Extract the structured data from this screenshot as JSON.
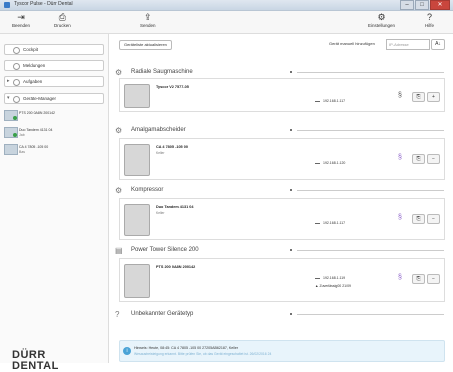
{
  "window": {
    "title": "Tyscor Pulse - Dürr Dental",
    "close": "✕",
    "min": "–",
    "max": "□"
  },
  "toolbar": {
    "beenden": {
      "label": "Beenden",
      "icon": "exit-icon"
    },
    "drucken": {
      "label": "Drucken",
      "icon": "printer-icon"
    },
    "senden": {
      "label": "Senden",
      "icon": "send-icon"
    },
    "einstellungen": {
      "label": "Einstellungen",
      "icon": "settings-icon"
    },
    "hilfe": {
      "label": "Hilfe",
      "icon": "help-icon"
    }
  },
  "sidebar": {
    "nav": [
      {
        "label": "Cockpit",
        "icon": "cockpit-icon"
      },
      {
        "label": "Meldungen",
        "icon": "messages-icon"
      },
      {
        "label": "Aufgaben",
        "icon": "tasks-icon"
      },
      {
        "label": "Geräte-Manager",
        "icon": "device-manager-icon"
      }
    ],
    "devices": [
      {
        "name": "PTS 200 0A8N 200142",
        "sub": ""
      },
      {
        "name": "Duo Tandem 4131 04",
        "sub": "Jab"
      },
      {
        "name": "CA 4 7805 -105 00",
        "sub": "Bas"
      }
    ],
    "logo": {
      "line1": "DÜRR",
      "line2": "DENTAL"
    }
  },
  "main": {
    "refresh_button": "Geräteliste aktualisieren",
    "manual_add": "Gerät manuell hinzufügen",
    "search_placeholder": "IP-Adresse",
    "sort_label": "A↓"
  },
  "sections": [
    {
      "title": "Radiale Saugmaschine",
      "icon": "suction-icon",
      "devices": [
        {
          "name": "Tyscor V2 7577-05",
          "status": "",
          "ip": "192.168.1.117",
          "extra": ""
        }
      ]
    },
    {
      "title": "Amalgamabscheider",
      "icon": "separator-icon",
      "devices": [
        {
          "name": "CA 4 7805 -105 00",
          "status": "Keller",
          "ip": "192.168.1.120",
          "extra": ""
        }
      ]
    },
    {
      "title": "Kompressor",
      "icon": "compressor-icon",
      "devices": [
        {
          "name": "Duo Tandem 4131 04",
          "status": "Keller",
          "ip": "192.168.1.117",
          "extra": ""
        }
      ]
    },
    {
      "title": "Power Tower Silence 200",
      "icon": "tower-icon",
      "devices": [
        {
          "name": "PTS 200 0A8N 200142",
          "status": "",
          "ip": "192.168.1.119",
          "extra": "Zuverlässig00 21/09"
        }
      ]
    },
    {
      "title": "Unbekannter Gerätetyp",
      "icon": "unknown-icon",
      "devices": []
    }
  ],
  "notice": {
    "line1": "Hinweis: Heute, 08:45: CA 4 7805 -105 00 27205AB62187, Keller",
    "line2": "Wesaustreisteigung erkannt. Bitte prüfen Sie, ob das Gerät eingeschaltet ist. 26/02/2016 24"
  }
}
